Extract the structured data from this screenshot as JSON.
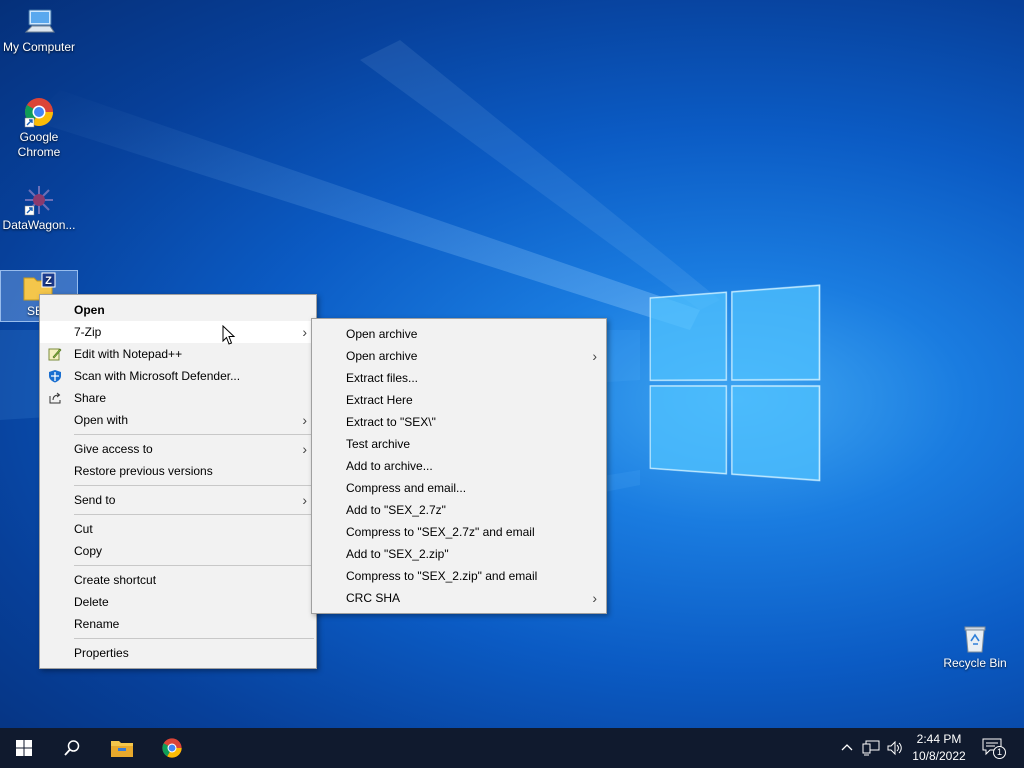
{
  "desktop": {
    "icons": [
      {
        "label": "My Computer",
        "icon": "computer-icon"
      },
      {
        "label": "Google Chrome",
        "icon": "chrome-icon"
      },
      {
        "label": "DataWagon...",
        "icon": "datawagon-icon"
      },
      {
        "label": "SEX",
        "icon": "zip-folder-icon"
      },
      {
        "label": "Recycle Bin",
        "icon": "recycle-bin-icon"
      }
    ]
  },
  "context_menu": {
    "items": [
      {
        "label": "Open",
        "bold": true
      },
      {
        "label": "7-Zip",
        "submenu": true,
        "highlighted": true
      },
      {
        "label": "Edit with Notepad++",
        "icon": "notepadpp-icon"
      },
      {
        "label": "Scan with Microsoft Defender...",
        "icon": "defender-icon"
      },
      {
        "label": "Share",
        "icon": "share-icon"
      },
      {
        "label": "Open with",
        "submenu": true
      },
      {
        "label": "Give access to",
        "submenu": true
      },
      {
        "label": "Restore previous versions"
      },
      {
        "label": "Send to",
        "submenu": true
      },
      {
        "label": "Cut"
      },
      {
        "label": "Copy"
      },
      {
        "label": "Create shortcut"
      },
      {
        "label": "Delete"
      },
      {
        "label": "Rename"
      },
      {
        "label": "Properties"
      }
    ]
  },
  "zip_submenu": {
    "items": [
      {
        "label": "Open archive"
      },
      {
        "label": "Open archive",
        "submenu": true
      },
      {
        "label": "Extract files..."
      },
      {
        "label": "Extract Here"
      },
      {
        "label": "Extract to \"SEX\\\""
      },
      {
        "label": "Test archive"
      },
      {
        "label": "Add to archive..."
      },
      {
        "label": "Compress and email..."
      },
      {
        "label": "Add to \"SEX_2.7z\""
      },
      {
        "label": "Compress to \"SEX_2.7z\" and email"
      },
      {
        "label": "Add to \"SEX_2.zip\""
      },
      {
        "label": "Compress to \"SEX_2.zip\" and email"
      },
      {
        "label": "CRC SHA",
        "submenu": true
      }
    ]
  },
  "taskbar": {
    "buttons": [
      "start-button",
      "search-button",
      "file-explorer-button",
      "chrome-button"
    ],
    "clock": {
      "time": "2:44 PM",
      "date": "10/8/2022"
    },
    "notification_count": "1",
    "submenu_arrow": "›"
  },
  "colors": {
    "menu_bg": "#f2f2f2",
    "menu_highlight": "#ffffff",
    "taskbar_bg": "#101a2e",
    "desktop_blue": "#0b5bc4"
  }
}
